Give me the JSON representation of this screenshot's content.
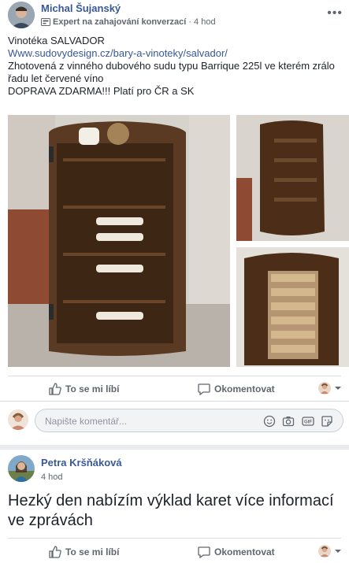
{
  "post1": {
    "author": "Michal Šujanský",
    "badge": "Expert na zahajování konverzací",
    "separator": "·",
    "time": "4 hod",
    "lines": [
      "Vinotéka SALVADOR",
      "Www.sudovydesign.cz/bary-a-vinoteky/salvador/",
      "Zhotovená z vinného dubového sudu typu Barrique 225l ve kterém zrálo",
      "řadu let červené víno",
      "DOPRAVA ZDARMA!!! Platí pro ČR a SK"
    ],
    "like_label": "To se mi líbí",
    "comment_label": "Okomentovat"
  },
  "composer": {
    "placeholder": "Napište komentář..."
  },
  "post2": {
    "author": "Petra Kršňáková",
    "time": "4 hod",
    "text": "Hezký den nabízím výklad karet více informací ve zprávách",
    "like_label": "To se mi líbí",
    "comment_label": "Okomentovat"
  },
  "colors": {
    "link": "#385898",
    "secondary": "#606770",
    "background": "#e9ebee"
  }
}
